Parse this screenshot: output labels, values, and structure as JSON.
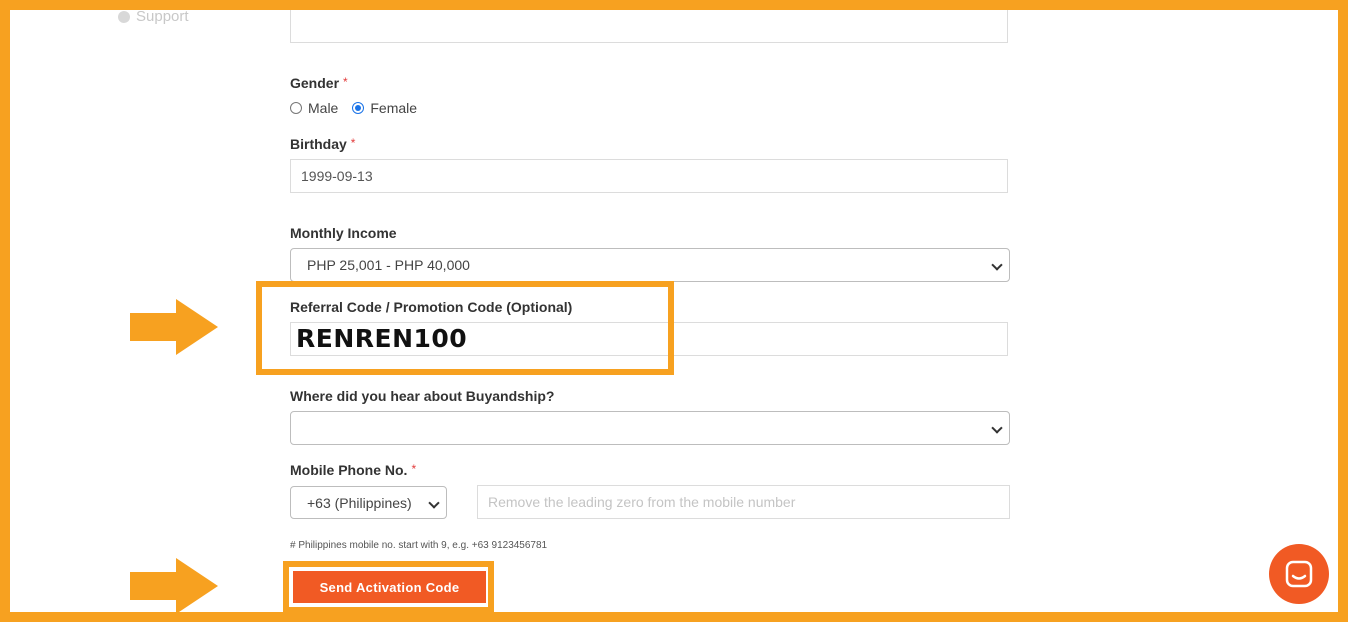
{
  "nav": {
    "support_label": "Support"
  },
  "form": {
    "gender": {
      "label": "Gender",
      "required_mark": "*",
      "options": [
        {
          "label": "Male",
          "selected": false
        },
        {
          "label": "Female",
          "selected": true
        }
      ]
    },
    "birthday": {
      "label": "Birthday",
      "required_mark": "*",
      "value": "1999-09-13"
    },
    "monthly_income": {
      "label": "Monthly Income",
      "value": "PHP 25,001 - PHP 40,000"
    },
    "referral": {
      "label": "Referral Code / Promotion Code (Optional)",
      "value": "RENREN100"
    },
    "heard_about": {
      "label": "Where did you hear about Buyandship?",
      "value": ""
    },
    "mobile": {
      "label": "Mobile Phone No.",
      "required_mark": "*",
      "country_code": "+63 (Philippines)",
      "placeholder": "Remove the leading zero from the mobile number",
      "hint": "# Philippines mobile no. start with 9, e.g. +63 9123456781"
    },
    "send_button_label": "Send Activation Code"
  },
  "colors": {
    "accent_orange": "#f15a24",
    "highlight_orange": "#f7a120",
    "radio_blue": "#1a73e8"
  },
  "icons": [
    "support-icon",
    "arrow-right-icon",
    "chevron-down-icon",
    "chat-icon"
  ]
}
